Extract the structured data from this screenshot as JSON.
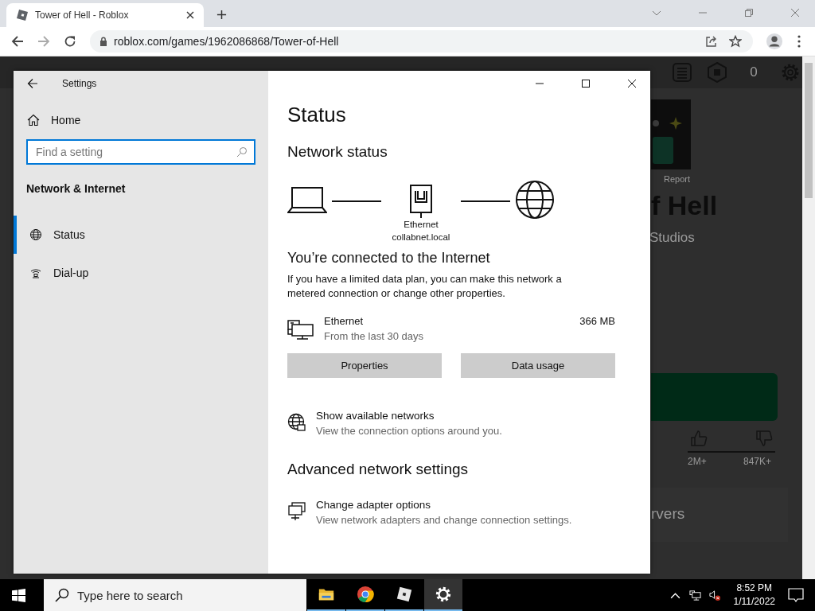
{
  "browser": {
    "tab_title": "Tower of Hell - Roblox",
    "url": "roblox.com/games/1962086868/Tower-of-Hell"
  },
  "background_page": {
    "robux": "0",
    "report": "Report",
    "title": "f Hell",
    "creator": "Studios",
    "likes": "2M+",
    "dislikes": "847K+",
    "section": "rvers"
  },
  "settings": {
    "title": "Settings",
    "home": "Home",
    "search": {
      "placeholder": "Find a setting"
    },
    "section": "Network & Internet",
    "nav": [
      {
        "kind": "status",
        "label": "Status",
        "selected": true
      },
      {
        "kind": "dialup",
        "label": "Dial-up",
        "selected": false
      }
    ],
    "page_title": "Status",
    "subtitle": "Network status",
    "diagram": {
      "adapter": "Ethernet",
      "network": "collabnet.local"
    },
    "connected": "You’re connected to the Internet",
    "description": "If you have a limited data plan, you can make this network a metered connection or change other properties.",
    "connection": {
      "name": "Ethernet",
      "period": "From the last 30 days",
      "usage": "366 MB"
    },
    "buttons": [
      "Properties",
      "Data usage"
    ],
    "show_networks": {
      "title": "Show available networks",
      "subtitle": "View the connection options around you."
    },
    "advanced": "Advanced network settings",
    "adapter_options": {
      "title": "Change adapter options",
      "subtitle": "View network adapters and change connection settings."
    }
  },
  "taskbar": {
    "search": {
      "placeholder": "Type here to search"
    },
    "apps": [
      {
        "kind": "explorer",
        "selected": false
      },
      {
        "kind": "chrome",
        "selected": false
      },
      {
        "kind": "roblox",
        "selected": false
      },
      {
        "kind": "settings",
        "selected": true
      }
    ],
    "time": "8:52 PM",
    "date": "1/11/2022"
  }
}
